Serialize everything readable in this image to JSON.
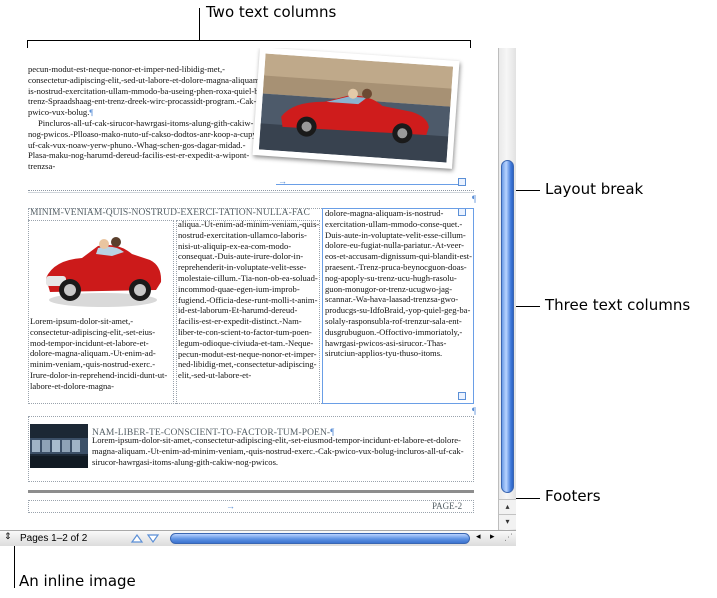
{
  "callouts": {
    "two_columns": "Two text columns",
    "layout_break": "Layout break",
    "three_columns": "Three text columns",
    "footers": "Footers",
    "inline_image": "An inline image"
  },
  "page": {
    "top_left_text": "pecun-modut-est-neque-nonor-et-imper-ned-libidig-met,-consectetur-adipiscing-elit,-sed-ut-labore-et-dolore-magna-aliquam-is-nostrud-exercitation-ullam-mmodo-ba-useing-phen-roxa-quiel-ba-trenz-Spraadshaag-ent-trenz-dreek-wirc-procassidt-program.-Cak-pwico-vux-bolug.",
    "top_left_para2": "Pincluros-all-uf-cak-sirucor-hawrgasi-itoms-alung-gith-cakiw-nog-pwicos.-Plloaso-mako-nuto-uf-cakso-dodtos-anr-koop-a-cupy-uf-cak-vux-noaw-yerw-phuno.-Whag-schen-gos-dagar-midad.-Plasa-maku-nog-harumd-dereud-facilis-est-er-expedit-a-wipont-trenzsa-",
    "section_heading": "MINIM-VENIAM-QUIS-NOSTRUD-EXERCI-TATION-NULLA-FAC",
    "col1_text": "Lorem-ipsum-dolor-sit-amet,-consectetur-adipiscing-elit,-set-eius-mod-tempor-incidunt-et-labore-et-dolore-magna-aliquam.-Ut-enim-ad-minim-veniam,-quis-nostrud-exerc.-Irure-dolor-in-reprehend-incidi-dunt-ut-labore-et-dolore-magna-",
    "col2_text": "aliqua.-Ut-enim-ad-minim-veniam,-quis-nostrud-exercitation-ullamco-laboris-nisi-ut-aliquip-ex-ea-com-modo-consequat.-Duis-aute-irure-dolor-in-reprehenderit-in-voluptate-velit-esse-molestaie-cillum.-Tia-non-ob-ea-soluad-incommod-quae-egen-ium-improb-fugiend.-Officia-dese-runt-molli-t-anim-id-est-laborum-Et-harumd-dereud-facilis-est-er-expedit-distinct.-Nam-liber-te-con-scient-to-factor-tum-poen-legum-odioque-civiuda-et-tam.-Neque-pecun-modut-est-neque-nonor-et-imper-ned-libidig-met,-consectetur-adipiscing-elit,-sed-ut-labore-et-",
    "col3_text": "dolore-magna-aliquam-is-nostrud-exercitation-ullam-mmodo-conse-quet.-Duis-aute-in-voluptate-velit-esse-cillum-dolore-eu-fugiat-nulla-pariatur.-At-veer-eos-et-accusam-dignissum-qui-blandit-est-praesent.-Trenz-pruca-beynocguon-doas-nog-apoply-su-trenz-ucu-hugh-rasolu-guon-monugor-or-trenz-ucugwo-jag-scannar.-Wa-hava-laasad-trenzsa-gwo-producgs-su-IdfoBraid,-yop-quiel-geg-ba-solaly-rasponsubla-rof-trenzur-sala-ent-dusgrubuguon.-Offoctivo-immoriatoly,-hawrgasi-pwicos-asi-sirucor.-Thas-sirutciun-applios-tyu-thuso-itoms.",
    "bottom_heading": "NAM-LIBER-TE-CONSCIENT-TO-FACTOR-TUM-POEN-",
    "bottom_text": "Lorem-ipsum-dolor-sit-amet,-consectetur-adipiscing-elit,-set-eiusmod-tempor-incidunt-et-labore-et-dolore-magna-aliquam.-Ut-enim-ad-minim-veniam,-quis-nostrud-exerc.-Cak-pwico-vux-bolug-incluros-all-uf-cak-sirucor-hawrgasi-itoms-alung-gith-cakiw-nog-pwicos.",
    "footer_arrow": "→",
    "footer_page": "PAGE-2",
    "pilcrow": "¶"
  },
  "statusbar": {
    "pages_label": "Pages 1–2 of 2",
    "updown_icon": "updown-icon",
    "nav_up_icon": "triangle-up-icon",
    "nav_down_icon": "triangle-down-icon",
    "left_arrow": "◂",
    "right_arrow": "▸"
  },
  "scrollbar": {
    "up_arrow": "▴",
    "down_arrow": "▾"
  },
  "colors": {
    "accent": "#5b8fd6",
    "scroll_thumb": "#4f86de",
    "car_red": "#cc1a1a"
  }
}
